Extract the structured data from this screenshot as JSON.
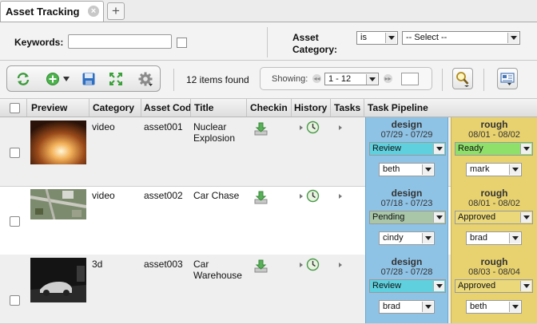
{
  "tab": {
    "title": "Asset Tracking",
    "close_glyph": "×",
    "add_glyph": "+"
  },
  "search": {
    "keywords_label": "Keywords:",
    "keywords_value": "",
    "category_label_1": "Asset",
    "category_label_2": "Category:",
    "operator": "is",
    "category_value": "-- Select --"
  },
  "toolbar": {
    "icons": [
      "refresh-icon",
      "add-icon",
      "save-icon",
      "expand-icon",
      "gear-icon"
    ],
    "items_found": "12 items found",
    "showing_label": "Showing:",
    "range": "1 - 12",
    "page_input": ""
  },
  "table": {
    "columns": [
      "Preview",
      "Category",
      "Asset Cod",
      "Title",
      "Checkin",
      "History",
      "Tasks",
      "Task Pipeline"
    ],
    "rows": [
      {
        "category": "video",
        "code": "asset001",
        "title_1": "Nuclear",
        "title_2": "Explosion",
        "design": {
          "name": "design",
          "dates": "07/29 - 07/29",
          "status": "Review",
          "status_color": "#5fd0de",
          "assignee": "beth"
        },
        "rough": {
          "name": "rough",
          "dates": "08/01 - 08/02",
          "status": "Ready",
          "status_color": "#8ee06a",
          "assignee": "mark"
        }
      },
      {
        "category": "video",
        "code": "asset002",
        "title_1": "Car Chase",
        "title_2": "",
        "design": {
          "name": "design",
          "dates": "07/18 - 07/23",
          "status": "Pending",
          "status_color": "#a9c7a8",
          "assignee": "cindy"
        },
        "rough": {
          "name": "rough",
          "dates": "08/01 - 08/02",
          "status": "Approved",
          "status_color": "#ead87a",
          "assignee": "brad"
        }
      },
      {
        "category": "3d",
        "code": "asset003",
        "title_1": "Car",
        "title_2": "Warehouse",
        "design": {
          "name": "design",
          "dates": "07/28 - 07/28",
          "status": "Review",
          "status_color": "#5fd0de",
          "assignee": "brad"
        },
        "rough": {
          "name": "rough",
          "dates": "08/03 - 08/04",
          "status": "Approved",
          "status_color": "#ead87a",
          "assignee": "beth"
        }
      }
    ]
  }
}
